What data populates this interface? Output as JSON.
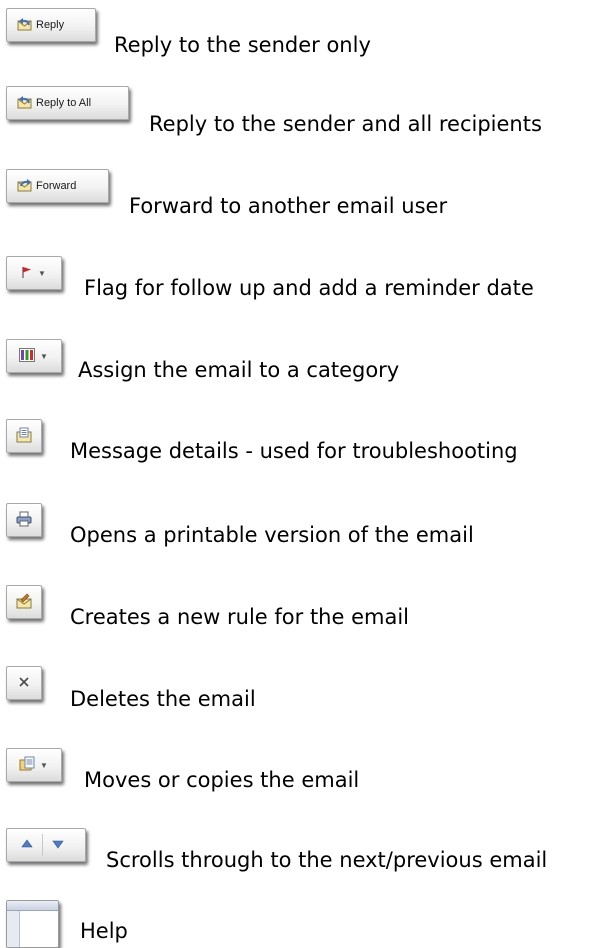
{
  "buttons": {
    "reply": "Reply",
    "reply_all": "Reply to All",
    "forward": "Forward"
  },
  "items": [
    {
      "icon": "reply-icon",
      "desc": "Reply to the sender only"
    },
    {
      "icon": "reply-all-icon",
      "desc": "Reply to the sender and all recipients"
    },
    {
      "icon": "forward-icon",
      "desc": "Forward to another email user"
    },
    {
      "icon": "flag-icon",
      "desc": "Flag for follow up and add a reminder date"
    },
    {
      "icon": "categorize-icon",
      "desc": "Assign the email to a category"
    },
    {
      "icon": "message-details-icon",
      "desc": "Message details - used for troubleshooting"
    },
    {
      "icon": "print-icon",
      "desc": "Opens a printable version of the email"
    },
    {
      "icon": "create-rule-icon",
      "desc": "Creates a new rule for the email"
    },
    {
      "icon": "delete-icon",
      "desc": "Deletes the email"
    },
    {
      "icon": "move-copy-icon",
      "desc": "Moves or copies the email"
    },
    {
      "icon": "previous-next-icon",
      "desc": "Scrolls through to the next/previous email"
    },
    {
      "icon": "help-icon",
      "desc": "Help"
    }
  ]
}
